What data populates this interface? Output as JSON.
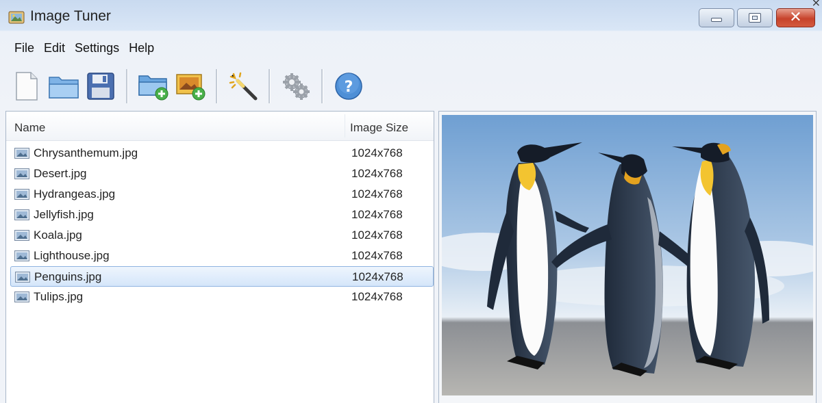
{
  "window": {
    "title": "Image Tuner",
    "controls": [
      "minimize",
      "maximize",
      "close"
    ]
  },
  "menu": [
    "File",
    "Edit",
    "Settings",
    "Help"
  ],
  "toolbar": {
    "buttons": [
      "new-file-icon",
      "open-folder-icon",
      "save-icon",
      "add-folder-icon",
      "add-image-icon",
      "magic-wand-icon",
      "gears-icon",
      "help-icon"
    ]
  },
  "file_list": {
    "columns": {
      "name": "Name",
      "size": "Image Size"
    },
    "rows": [
      {
        "name": "Chrysanthemum.jpg",
        "size": "1024x768"
      },
      {
        "name": "Desert.jpg",
        "size": "1024x768"
      },
      {
        "name": "Hydrangeas.jpg",
        "size": "1024x768"
      },
      {
        "name": "Jellyfish.jpg",
        "size": "1024x768"
      },
      {
        "name": "Koala.jpg",
        "size": "1024x768"
      },
      {
        "name": "Lighthouse.jpg",
        "size": "1024x768"
      },
      {
        "name": "Penguins.jpg",
        "size": "1024x768"
      },
      {
        "name": "Tulips.jpg",
        "size": "1024x768"
      }
    ],
    "selected_index": 6
  },
  "preview": {
    "subject": "penguins"
  },
  "colors": {
    "selection": "#d5e6fa",
    "selection_border": "#8fb3e0",
    "close_button": "#c7432b"
  }
}
